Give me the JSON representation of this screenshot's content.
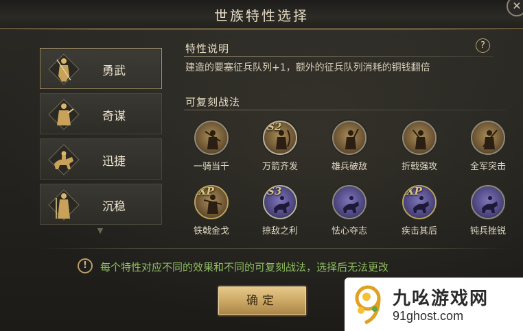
{
  "window": {
    "title": "世族特性选择"
  },
  "traits": [
    {
      "label": "勇武",
      "icon": "warrior-icon",
      "selected": true
    },
    {
      "label": "奇谋",
      "icon": "strategist-icon",
      "selected": false
    },
    {
      "label": "迅捷",
      "icon": "cavalry-icon",
      "selected": false
    },
    {
      "label": "沉稳",
      "icon": "sage-icon",
      "selected": false
    }
  ],
  "description": {
    "heading": "特性说明",
    "text": "建造的要塞征兵队列+1，额外的征兵队列消耗的铜钱翻倍"
  },
  "skills_section": {
    "heading": "可复刻战法",
    "skills": [
      {
        "name": "一骑当千",
        "tag": "",
        "style": "gold"
      },
      {
        "name": "万箭齐发",
        "tag": "S2",
        "style": "gold"
      },
      {
        "name": "雄兵破敌",
        "tag": "",
        "style": "gold"
      },
      {
        "name": "折戟强攻",
        "tag": "",
        "style": "gold"
      },
      {
        "name": "全军突击",
        "tag": "",
        "style": "gold"
      },
      {
        "name": "铁戟金戈",
        "tag": "XP",
        "style": "gold"
      },
      {
        "name": "掠敌之利",
        "tag": "S3",
        "style": "purple"
      },
      {
        "name": "怯心夺志",
        "tag": "",
        "style": "purple"
      },
      {
        "name": "疾击其后",
        "tag": "XP",
        "style": "purple"
      },
      {
        "name": "钝兵挫锐",
        "tag": "",
        "style": "purple"
      }
    ]
  },
  "notice": {
    "text": "每个特性对应不同的效果和不同的可复刻战法，选择后无法更改",
    "icon": "warning-icon"
  },
  "buttons": {
    "confirm": "确定",
    "close": "✕",
    "help": "?"
  },
  "watermark": {
    "cn": "九吆游戏网",
    "en": "91ghost.com"
  },
  "colors": {
    "accent_gold": "#c9a561",
    "notice_green": "#8fbf62",
    "selected_border": "#a8956a"
  }
}
